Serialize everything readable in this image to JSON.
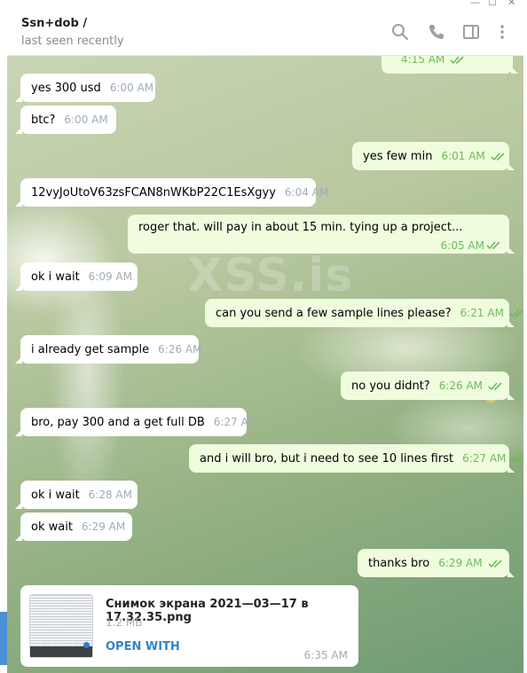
{
  "header": {
    "title": "Ssn+dob /",
    "status": "last seen recently",
    "icons": [
      "search-icon",
      "phone-icon",
      "sidebar-toggle-icon",
      "more-vertical-icon"
    ]
  },
  "watermark": "XSS.is",
  "messages": [
    {
      "dir": "out",
      "text": "",
      "time": "4:15 AM"
    },
    {
      "dir": "in",
      "text": "yes 300 usd",
      "time": "6:00 AM"
    },
    {
      "dir": "in",
      "text": "btc?",
      "time": "6:00 AM"
    },
    {
      "dir": "out",
      "text": "yes few min",
      "time": "6:01 AM"
    },
    {
      "dir": "in",
      "text": "12vyJoUtoV63zsFCAN8nWKbP22C1EsXgyy",
      "time": "6:04 AM"
    },
    {
      "dir": "out",
      "text": "roger that. will pay in about 15 min. tying up a project...",
      "time": "6:05 AM"
    },
    {
      "dir": "in",
      "text": "ok i wait",
      "time": "6:09 AM"
    },
    {
      "dir": "out",
      "text": "can you send a few sample lines please?",
      "time": "6:21 AM"
    },
    {
      "dir": "in",
      "text": "i already get sample",
      "time": "6:26 AM"
    },
    {
      "dir": "out",
      "text": "no you didnt?",
      "time": "6:26 AM"
    },
    {
      "dir": "in",
      "text": "bro, pay 300 and a get full DB",
      "time": "6:27 AM"
    },
    {
      "dir": "out",
      "text": "and i will bro, but i need to see 10 lines first",
      "time": "6:27 AM"
    },
    {
      "dir": "in",
      "text": "ok i wait",
      "time": "6:28 AM"
    },
    {
      "dir": "in",
      "text": "ok wait",
      "time": "6:29 AM"
    },
    {
      "dir": "out",
      "text": "thanks bro",
      "time": "6:29 AM"
    }
  ],
  "file": {
    "name": "Снимок экрана 2021—03—17 в 17.32.35.png",
    "size": "1.2 MB",
    "action": "OPEN WITH",
    "time": "6:35 AM"
  },
  "colors": {
    "incoming_bubble": "#ffffff",
    "outgoing_bubble": "#effdde",
    "outgoing_time": "#6cbb5b",
    "link": "#2e87c8"
  }
}
